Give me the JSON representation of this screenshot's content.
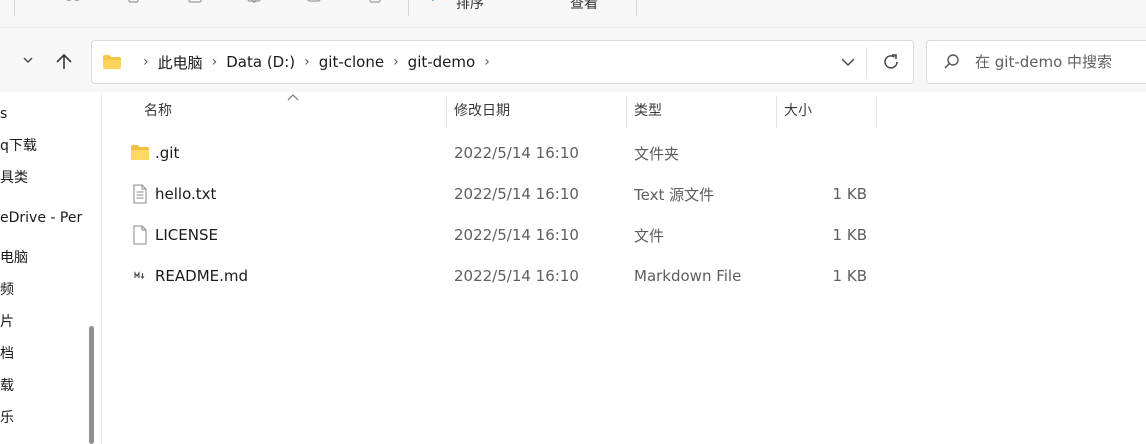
{
  "toolbar": {
    "sort_label": "排序",
    "view_label": "查看"
  },
  "breadcrumb": {
    "items": [
      "此电脑",
      "Data (D:)",
      "git-clone",
      "git-demo"
    ]
  },
  "search": {
    "placeholder": "在 git-demo 中搜索"
  },
  "sidebar": {
    "items": [
      "s",
      "q下载",
      "具类",
      "eDrive - Per",
      "电脑",
      "频",
      "片",
      "档",
      "载",
      "乐"
    ]
  },
  "columns": {
    "name": "名称",
    "modified": "修改日期",
    "type": "类型",
    "size": "大小"
  },
  "files": [
    {
      "name": ".git",
      "modified": "2022/5/14 16:10",
      "type": "文件夹",
      "size": "",
      "icon": "folder-icon"
    },
    {
      "name": "hello.txt",
      "modified": "2022/5/14 16:10",
      "type": "Text 源文件",
      "size": "1 KB",
      "icon": "text-file-icon"
    },
    {
      "name": "LICENSE",
      "modified": "2022/5/14 16:10",
      "type": "文件",
      "size": "1 KB",
      "icon": "blank-file-icon"
    },
    {
      "name": "README.md",
      "modified": "2022/5/14 16:10",
      "type": "Markdown File",
      "size": "1 KB",
      "icon": "markdown-file-icon"
    }
  ],
  "colors": {
    "folder": "#f5c745",
    "accent": "#0067c0",
    "chrome_bg": "#f7f7f7"
  }
}
